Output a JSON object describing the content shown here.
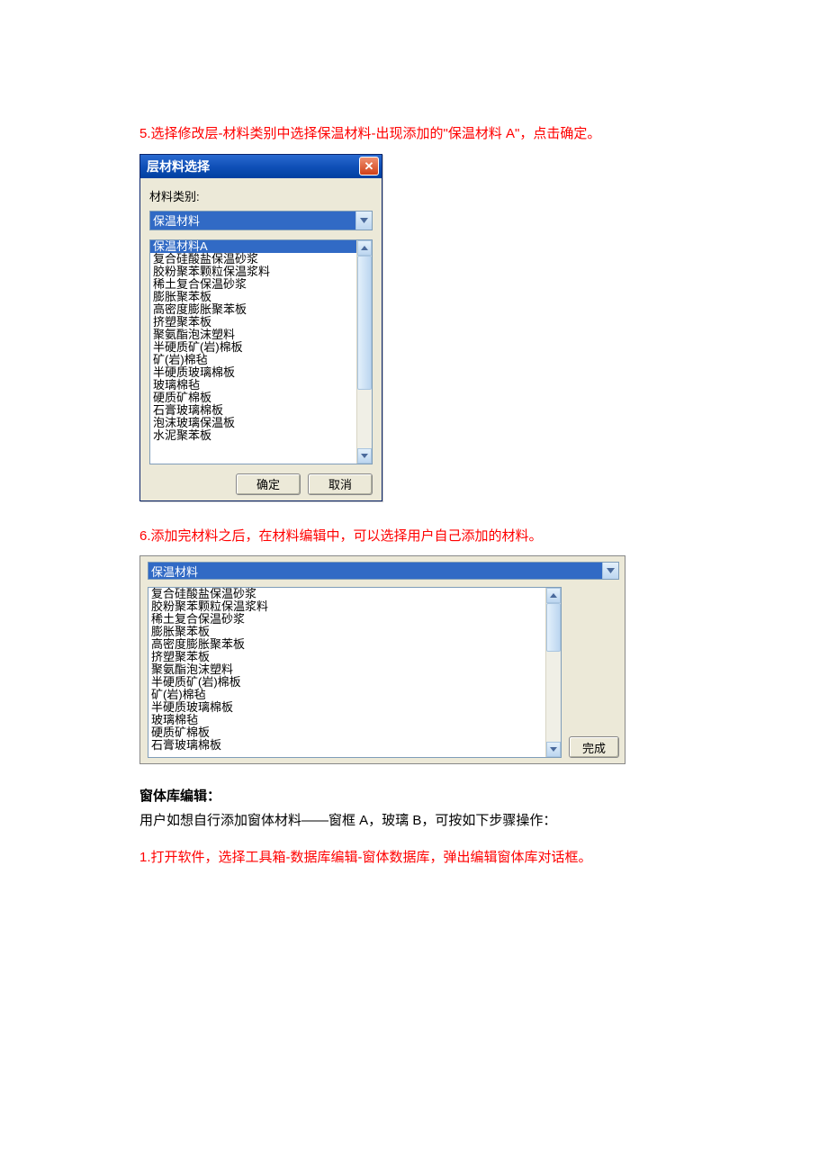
{
  "step5": "5.选择修改层-材料类别中选择保温材料-出现添加的\"保温材料 A\"，点击确定。",
  "dialog1": {
    "title": "层材料选择",
    "category_label": "材料类别:",
    "category_value": "保温材料",
    "items": [
      "保温材料A",
      "复合硅酸盐保温砂浆",
      "胶粉聚苯颗粒保温浆料",
      "稀土复合保温砂浆",
      "膨胀聚苯板",
      "高密度膨胀聚苯板",
      "挤塑聚苯板",
      "聚氨酯泡沫塑料",
      "半硬质矿(岩)棉板",
      "矿(岩)棉毡",
      "半硬质玻璃棉板",
      "玻璃棉毡",
      "硬质矿棉板",
      "石膏玻璃棉板",
      "泡沫玻璃保温板",
      "水泥聚苯板"
    ],
    "ok": "确定",
    "cancel": "取消"
  },
  "step6": "6.添加完材料之后，在材料编辑中，可以选择用户自己添加的材料。",
  "panel2": {
    "combo_value": "保温材料",
    "items": [
      "复合硅酸盐保温砂浆",
      "胶粉聚苯颗粒保温浆料",
      "稀土复合保温砂浆",
      "膨胀聚苯板",
      "高密度膨胀聚苯板",
      "挤塑聚苯板",
      "聚氨酯泡沫塑料",
      "半硬质矿(岩)棉板",
      "矿(岩)棉毡",
      "半硬质玻璃棉板",
      "玻璃棉毡",
      "硬质矿棉板",
      "石膏玻璃棉板"
    ],
    "finish": "完成"
  },
  "section_heading": "窗体库编辑：",
  "section_body": "用户如想自行添加窗体材料——窗框 A，玻璃 B，可按如下步骤操作：",
  "step1b": "1.打开软件，选择工具箱-数据库编辑-窗体数据库，弹出编辑窗体库对话框。"
}
